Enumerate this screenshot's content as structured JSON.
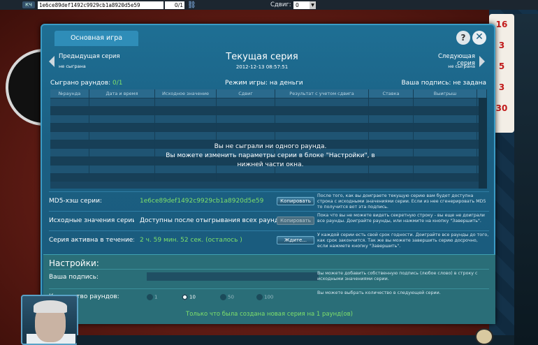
{
  "topbar": {
    "ks_label": "КЧ",
    "hash": "1e6ce89def1492c9929cb1a8920d5e59",
    "count": "0/1",
    "shift_label": "Сдвиг:",
    "shift_value": "0"
  },
  "right_strip": [
    "16",
    "3",
    "5",
    "3",
    "30"
  ],
  "dialog": {
    "tab_label": "Основная игра",
    "help_label": "?",
    "close_label": "✕",
    "prev": {
      "title": "Предыдущая серия",
      "status": "не сыграна"
    },
    "next": {
      "title": "Следующая серия",
      "status": "не сыграна"
    },
    "current": {
      "title": "Текущая серия",
      "date": "2012-12-13 08:57:51"
    },
    "stats": {
      "played_label": "Сыграно раундов:",
      "played_value": "0/1",
      "mode": "Режим игры: на деньги",
      "signature": "Ваша подпись: не задана"
    },
    "table": {
      "columns": [
        "№раунда",
        "Дата и время",
        "Исходное значение",
        "Сдвиг",
        "Результат с учетом сдвига",
        "Ставка",
        "Выигрыш"
      ],
      "empty_message_1": "Вы не сыграли ни одного раунда.",
      "empty_message_2": "Вы можете изменить параметры серии в блоке \"Настройки\", в",
      "empty_message_3": "нижней части окна."
    },
    "md5": {
      "label": "MD5-хэш серии:",
      "value": "1e6ce89def1492c9929cb1a8920d5e59",
      "button": "Копировать",
      "desc": "После того, как вы доиграете текущую серию вам будет доступна строка с исходными значениями серии. Если из нее сгенерировать MD5 то получится вот эта подпись."
    },
    "initial": {
      "label": "Исходные значения серии:",
      "value": "Доступны после отыгрывания всех раундов",
      "button": "Копировать",
      "desc": "Пока что вы не можете видеть секретную строку - вы еще не доиграли все раунды. Доиграйте раунды, или нажмите на кнопку \"Завершить\"."
    },
    "active": {
      "label": "Серия активна в течение:",
      "value": "2 ч. 59 мин. 52 сек.  (осталось )",
      "button": "Ждите...",
      "desc": "У каждой серии есть свой срок годности. Доиграйте все раунды до того, как срок закончится. Так же вы можете завершить серию досрочно, если нажмете кнопку \"Завершить\"."
    },
    "settings": {
      "head": "Настройки:",
      "sign_label": "Ваша подпись:",
      "sign_desc": "Вы можете добавить собственную подпись (любое слово) в строку с исходными значениями серии.",
      "rounds_label": "Количество раундов:",
      "rounds_desc": "Вы можете выбрать количество в следующей серии.",
      "rounds_options": [
        "1",
        "10",
        "50",
        "100"
      ],
      "status": "Только что была создана новая серия на 1 раунд(ов)"
    }
  }
}
